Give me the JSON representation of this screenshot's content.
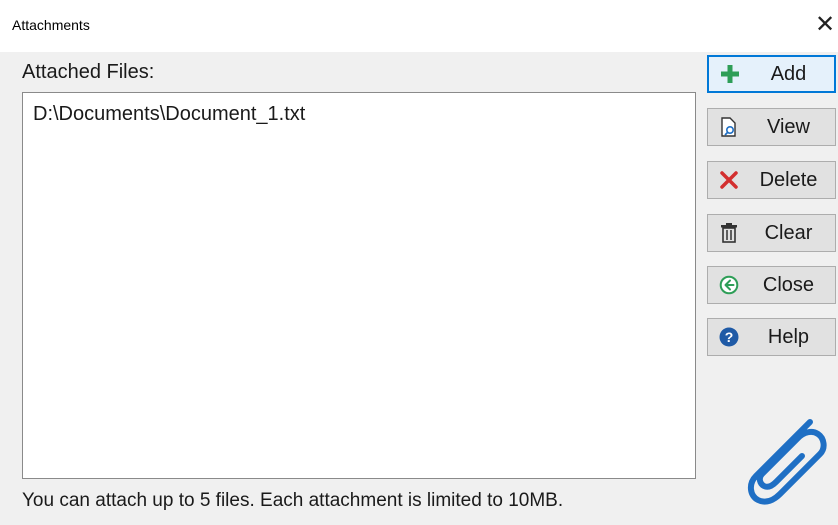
{
  "window": {
    "title": "Attachments",
    "close_glyph": "✕"
  },
  "attached_files_label": "Attached Files:",
  "files": [
    "D:\\Documents\\Document_1.txt"
  ],
  "buttons": {
    "add": {
      "label": "Add",
      "icon": "plus-icon"
    },
    "view": {
      "label": "View",
      "icon": "view-document-icon"
    },
    "delete": {
      "label": "Delete",
      "icon": "delete-x-icon"
    },
    "clear": {
      "label": "Clear",
      "icon": "trash-icon"
    },
    "close": {
      "label": "Close",
      "icon": "back-arrow-circle-icon"
    },
    "help": {
      "label": "Help",
      "icon": "help-icon"
    }
  },
  "footer_text": "You can attach up to 5 files. Each attachment is limited to 10MB.",
  "colors": {
    "accent": "#0078d7",
    "plus_green": "#2e9e57",
    "delete_red": "#d32f2f",
    "help_blue": "#1f5aa6",
    "clip_blue": "#1f6fc4"
  }
}
